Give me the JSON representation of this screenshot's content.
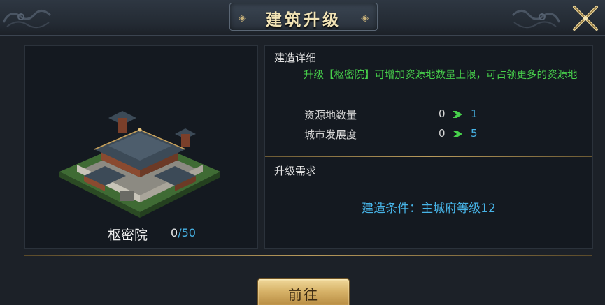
{
  "header": {
    "title": "建筑升级",
    "left_ornament": "◈",
    "right_ornament": "◈"
  },
  "building": {
    "name": "枢密院",
    "current": "0",
    "separator": "/",
    "max": "50"
  },
  "details": {
    "section_title": "建造详细",
    "description": "升级【枢密院】可增加资源地数量上限，可占领更多的资源地",
    "stats": [
      {
        "label": "资源地数量",
        "from": "0",
        "to": "1"
      },
      {
        "label": "城市发展度",
        "from": "0",
        "to": "5"
      }
    ]
  },
  "requirements": {
    "section_title": "升级需求",
    "condition": "建造条件：主城府等级12"
  },
  "actions": {
    "go_label": "前往"
  },
  "colors": {
    "accent_green": "#47d04b",
    "accent_blue": "#47b3e6",
    "gold": "#d8b46a"
  }
}
